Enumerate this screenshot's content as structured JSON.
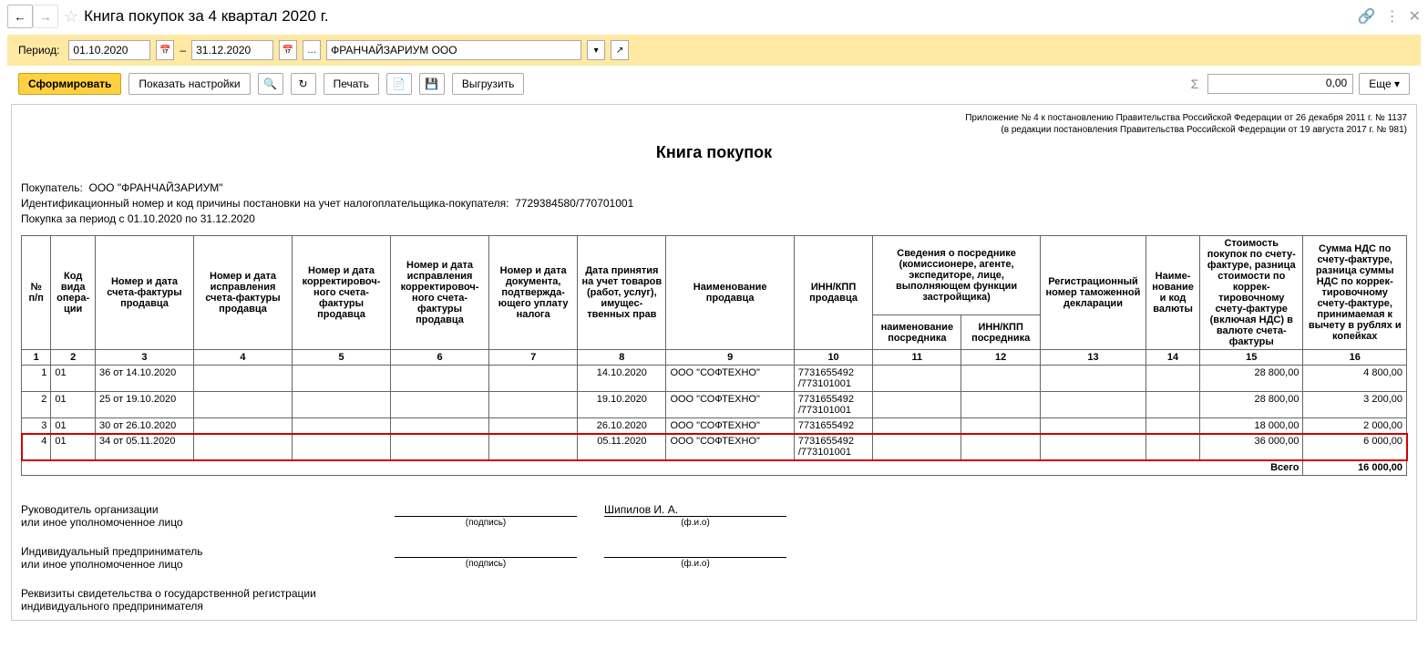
{
  "title": "Книга покупок за 4 квартал 2020 г.",
  "period": {
    "label": "Период:",
    "from": "01.10.2020",
    "to": "31.12.2020",
    "sep": "–"
  },
  "org": "ФРАНЧАЙЗАРИУМ ООО",
  "toolbar": {
    "generate": "Сформировать",
    "settings": "Показать настройки",
    "print": "Печать",
    "export": "Выгрузить",
    "sum": "0,00",
    "more": "Еще"
  },
  "legal1": "Приложение № 4 к постановлению Правительства Российской Федерации от 26 декабря 2011 г. № 1137",
  "legal2": "(в редакции постановления Правительства Российской Федерации от 19 августа 2017 г. № 981)",
  "report_title": "Книга покупок",
  "info": {
    "buyer_lbl": "Покупатель:",
    "buyer": "ООО \"ФРАНЧАЙЗАРИУМ\"",
    "inn_lbl": "Идентификационный номер и код причины постановки на учет налогоплательщика-покупателя:",
    "inn": "7729384580/770701001",
    "period_lbl": "Покупка за период с 01.10.2020 по 31.12.2020"
  },
  "headers": {
    "c1": "№ п/п",
    "c2": "Код вида опера­ции",
    "c3": "Номер и дата счета-фактуры продавца",
    "c4": "Номер и дата исправления счета-фактуры продавца",
    "c5": "Номер и дата корректировоч­ного счета-фактуры продавца",
    "c6": "Номер и дата исправления корректировоч­ного счета-фактуры продавца",
    "c7": "Номер и дата документа, подтвержда­ющего уплату налога",
    "c8": "Дата принятия на учет товаров (работ, услуг), имущес­твенных прав",
    "c9": "Наименование продавца",
    "c10": "ИНН/КПП продавца",
    "c11top": "Сведения о посреднике (комиссионере, агенте, экспедиторе, лице, выполняющем функции застройщика)",
    "c11": "наименование посредника",
    "c12": "ИНН/КПП посредника",
    "c13": "Регистрационный номер таможенной декларации",
    "c14": "Наиме­нование и код валюты",
    "c15": "Стоимость покупок по счету-фактуре, разница стои­мости по коррек­тировочному счету-фактуре (включая НДС) в валюте счета-фактуры",
    "c16": "Сумма НДС по счету-фактуре, разница суммы НДС по коррек­тировочному счету-фактуре, принимаемая к вычету в рублях и копейках"
  },
  "colnums": [
    "1",
    "2",
    "3",
    "4",
    "5",
    "6",
    "7",
    "8",
    "9",
    "10",
    "11",
    "12",
    "13",
    "14",
    "15",
    "16"
  ],
  "rows": [
    {
      "n": "1",
      "code": "01",
      "sf": "36 от 14.10.2020",
      "date": "14.10.2020",
      "seller": "ООО \"СОФТЕХНО\"",
      "inn": "7731655492 /773101001",
      "cost": "28 800,00",
      "vat": "4 800,00",
      "hl": false
    },
    {
      "n": "2",
      "code": "01",
      "sf": "25 от 19.10.2020",
      "date": "19.10.2020",
      "seller": "ООО \"СОФТЕХНО\"",
      "inn": "7731655492 /773101001",
      "cost": "28 800,00",
      "vat": "3 200,00",
      "hl": false
    },
    {
      "n": "3",
      "code": "01",
      "sf": "30 от 26.10.2020",
      "date": "26.10.2020",
      "seller": "ООО \"СОФТЕХНО\"",
      "inn": "7731655492",
      "cost": "18 000,00",
      "vat": "2 000,00",
      "hl": false
    },
    {
      "n": "4",
      "code": "01",
      "sf": "34 от 05.11.2020",
      "date": "05.11.2020",
      "seller": "ООО \"СОФТЕХНО\"",
      "inn": "7731655492 /773101001",
      "cost": "36 000,00",
      "vat": "6 000,00",
      "hl": true
    }
  ],
  "total": {
    "label": "Всего",
    "value": "16 000,00"
  },
  "sign": {
    "head_lbl1": "Руководитель организации",
    "head_lbl2": "или иное уполномоченное лицо",
    "ip_lbl1": "Индивидуальный предприниматель",
    "ip_lbl2": "или иное уполномоченное лицо",
    "reg_lbl": "Реквизиты свидетельства о государственной регистрации индивидуального предпринимателя",
    "podpis": "(подпись)",
    "fio": "(ф.и.о)",
    "head_name": "Шипилов И. А."
  }
}
